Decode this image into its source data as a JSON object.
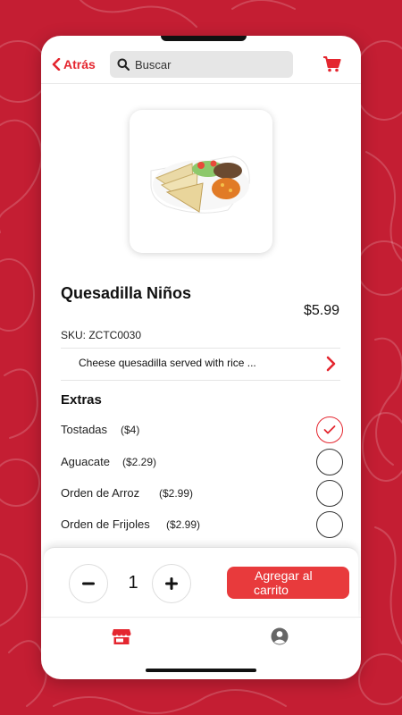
{
  "colors": {
    "background": "#c41e33",
    "accent": "#e4262f",
    "add_button": "#e83a3c"
  },
  "header": {
    "back_label": "Atrás",
    "back_icon": "chevron-left-icon",
    "search_placeholder": "Buscar",
    "search_icon": "search-icon",
    "cart_icon": "cart-icon"
  },
  "product": {
    "image_alt": "Quesadilla with beans, rice and salad",
    "name": "Quesadilla Niños",
    "price": "$5.99",
    "sku": "SKU: ZCTC0030",
    "description": "Cheese quesadilla served with rice ..."
  },
  "extras": {
    "title": "Extras",
    "items": [
      {
        "name": "Tostadas",
        "price": "($4)",
        "checked": true
      },
      {
        "name": "Aguacate",
        "price": "($2.29)",
        "checked": false
      },
      {
        "name": "Orden de Arroz",
        "price": "($2.99)",
        "checked": false
      },
      {
        "name": "Orden de Frijoles",
        "price": "($2.99)",
        "checked": false
      }
    ]
  },
  "order": {
    "quantity": "1",
    "add_label_line1": "Agregar al",
    "add_label_line2": "carrito"
  },
  "tabbar": {
    "items": [
      {
        "icon": "store-icon",
        "active": true
      },
      {
        "icon": "profile-icon",
        "active": false
      }
    ]
  }
}
